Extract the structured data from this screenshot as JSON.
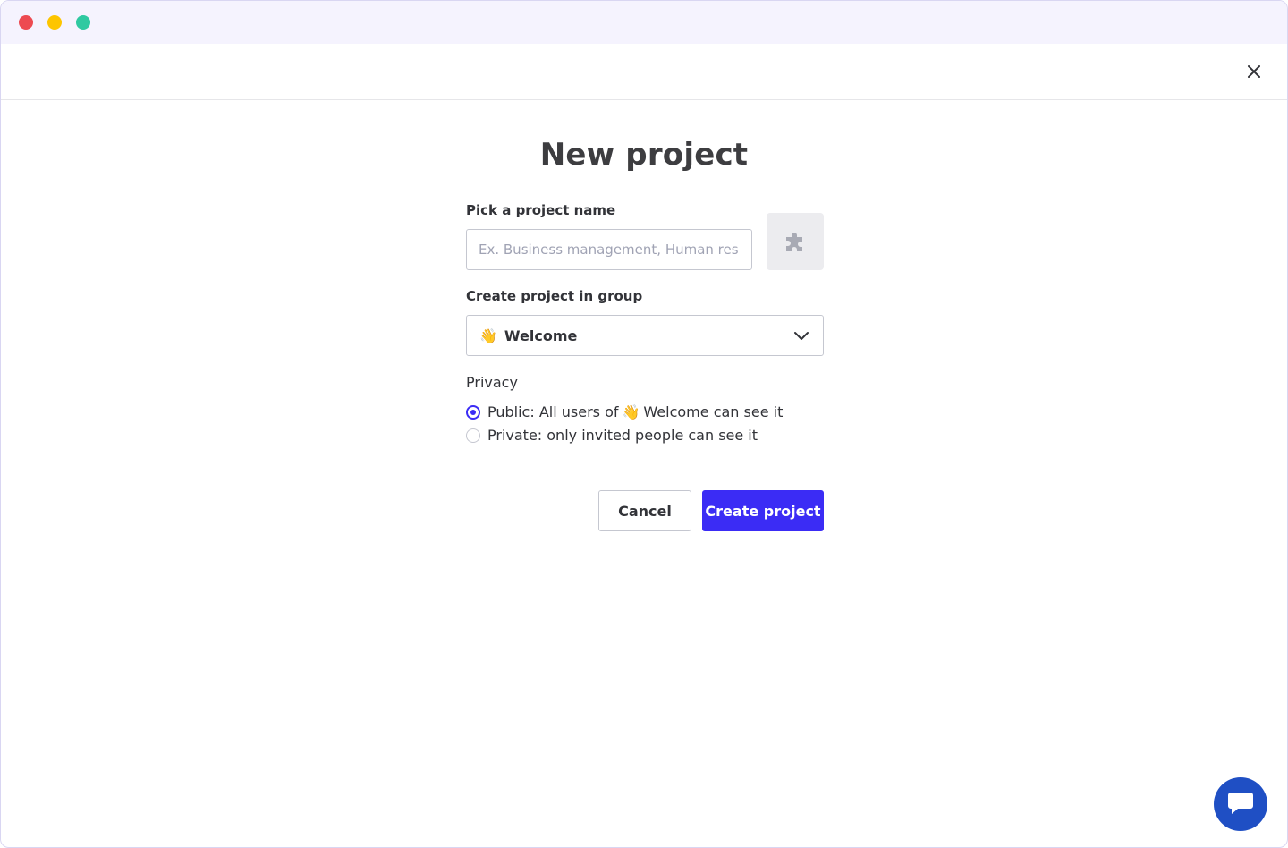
{
  "window": {
    "controls": [
      "close-dot",
      "minimize-dot",
      "maximize-dot"
    ]
  },
  "dialog": {
    "title": "New project",
    "close_icon": "close-icon"
  },
  "form": {
    "name_label": "Pick a project name",
    "name_placeholder": "Ex. Business management, Human res",
    "name_value": "",
    "icon_picker_icon": "puzzle-piece-icon",
    "group_label": "Create project in group",
    "group_emoji": "👋",
    "group_value": "Welcome",
    "privacy_label": "Privacy",
    "privacy_options": {
      "public_prefix": "Public: All users of",
      "public_emoji": "👋",
      "public_suffix": "Welcome can see it",
      "public_selected": true,
      "private_text": "Private: only invited people can see it",
      "private_selected": false
    }
  },
  "actions": {
    "cancel_label": "Cancel",
    "create_label": "Create project"
  },
  "colors": {
    "primary": "#3b2cf5",
    "titlebar": "#f5f3fe",
    "chat": "#1f4fc4"
  },
  "chat": {
    "icon": "chat-icon"
  }
}
